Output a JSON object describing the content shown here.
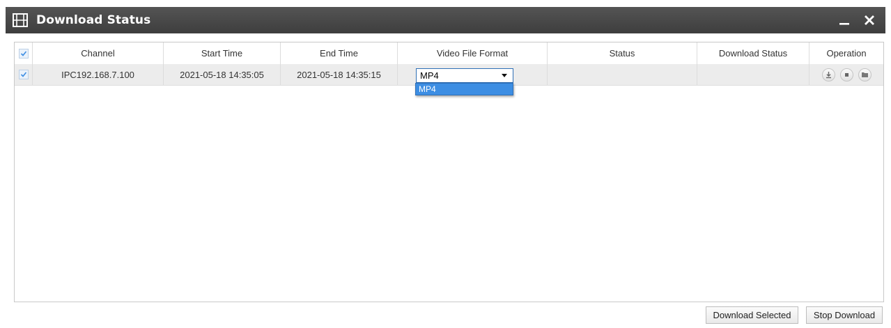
{
  "window": {
    "title": "Download Status",
    "minimize_label": "_",
    "close_label": "✕"
  },
  "table": {
    "columns": [
      "Channel",
      "Start Time",
      "End Time",
      "Video File Format",
      "Status",
      "Download Status",
      "Operation"
    ],
    "header_checked": true,
    "rows": [
      {
        "checked": true,
        "channel": "IPC192.168.7.100",
        "start_time": "2021-05-18 14:35:05",
        "end_time": "2021-05-18 14:35:15",
        "format": "MP4",
        "status": "",
        "download_status": "",
        "operations": [
          "download-icon",
          "stop-icon",
          "folder-icon"
        ]
      }
    ]
  },
  "format_dropdown": {
    "selected": "MP4",
    "options": [
      "MP4"
    ],
    "open": true
  },
  "footer": {
    "download_selected": "Download Selected",
    "stop_download": "Stop Download"
  },
  "colors": {
    "titlebar": "#4a4a4a",
    "accent": "#3d8ee3",
    "row_bg": "#ececec"
  }
}
